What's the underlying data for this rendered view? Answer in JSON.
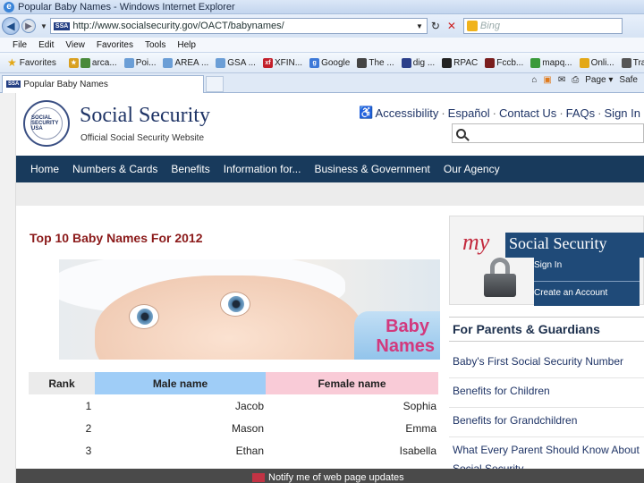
{
  "browser": {
    "window_title": "Popular Baby Names - Windows Internet Explorer",
    "url": "http://www.socialsecurity.gov/OACT/babynames/",
    "url_badge": "SSA",
    "search_placeholder": "Bing",
    "menu": [
      "File",
      "Edit",
      "View",
      "Favorites",
      "Tools",
      "Help"
    ],
    "favorites_label": "Favorites",
    "favorites_links": [
      "arca...",
      "Poi...",
      "AREA ...",
      "GSA ...",
      "XFIN...",
      "Google",
      "The ...",
      "dig ...",
      "RPAC",
      "Fccb...",
      "mapq...",
      "Onli...",
      "Trav..."
    ],
    "tab_title": "Popular Baby Names",
    "tab_badge": "SSA",
    "command_bar": [
      "Page ▾",
      "Safe"
    ]
  },
  "header": {
    "seal_text": "SOCIAL SECURITY USA",
    "brand_title": "Social Security",
    "brand_subtitle": "Official Social Security Website",
    "top_links": [
      "Accessibility",
      "Español",
      "Contact Us",
      "FAQs",
      "Sign In"
    ],
    "search_placeholder": ""
  },
  "nav": {
    "items": [
      "Home",
      "Numbers & Cards",
      "Benefits",
      "Information for...",
      "Business & Government",
      "Our Agency"
    ]
  },
  "main": {
    "title": "Top 10 Baby Names For 2012",
    "hero_text_line1": "Baby",
    "hero_text_line2": "Names",
    "table": {
      "headers": [
        "Rank",
        "Male name",
        "Female name"
      ],
      "rows": [
        {
          "rank": "1",
          "male": "Jacob",
          "female": "Sophia"
        },
        {
          "rank": "2",
          "male": "Mason",
          "female": "Emma"
        },
        {
          "rank": "3",
          "male": "Ethan",
          "female": "Isabella"
        }
      ]
    }
  },
  "sidebar": {
    "my_word": "my",
    "my_brand": "Social Security",
    "sign_in": "Sign In",
    "create_account": "Create an Account",
    "guardians_heading": "For Parents & Guardians",
    "guardians_links": [
      "Baby's First Social Security Number",
      "Benefits for Children",
      "Benefits for Grandchildren",
      "What Every Parent Should Know About Social Security"
    ]
  },
  "footer": {
    "notify_text": "Notify me of web page updates"
  }
}
